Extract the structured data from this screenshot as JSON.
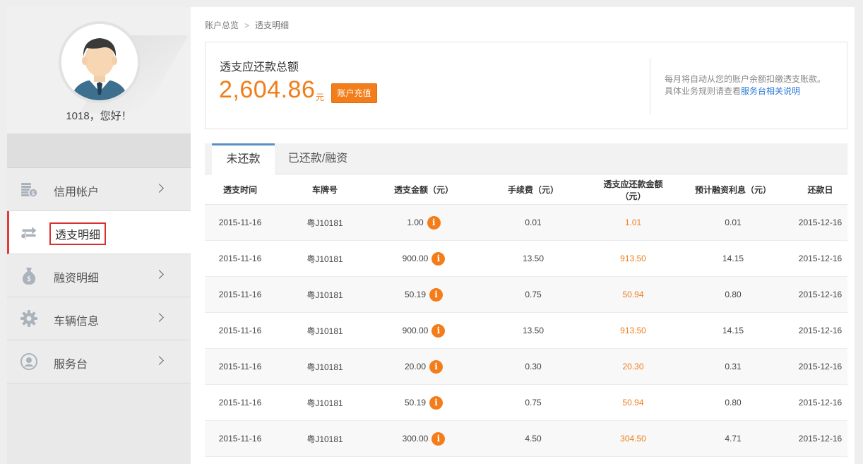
{
  "user": {
    "greeting": "1018，您好！"
  },
  "sidebar": {
    "items": [
      {
        "label": "信用帐户",
        "icon": "coins-icon"
      },
      {
        "label": "透支明细",
        "icon": "transfer-icon",
        "active": true
      },
      {
        "label": "融资明细",
        "icon": "money-bag-icon"
      },
      {
        "label": "车辆信息",
        "icon": "gear-icon"
      },
      {
        "label": "服务台",
        "icon": "service-icon"
      }
    ]
  },
  "breadcrumb": {
    "home": "账户总览",
    "current": "透支明细"
  },
  "summary": {
    "title": "透支应还款总额",
    "amount": "2,604.86",
    "unit": "元",
    "recharge_label": "账户充值",
    "note_line1": "每月将自动从您的账户余额扣缴透支账款。",
    "note_line2_prefix": "具体业务规则请查看",
    "note_link": "服务台相关说明"
  },
  "tabs": [
    {
      "label": "未还款",
      "active": true
    },
    {
      "label": "已还款/融资"
    }
  ],
  "table": {
    "columns": [
      "透支时间",
      "车牌号",
      "透支金额（元）",
      "手续费（元）",
      "透支应还款金额（元）",
      "预计融资利息（元）",
      "还款日"
    ],
    "rows": [
      [
        "2015-11-16",
        "粤J10181",
        "1.00",
        "0.01",
        "1.01",
        "0.01",
        "2015-12-16"
      ],
      [
        "2015-11-16",
        "粤J10181",
        "900.00",
        "13.50",
        "913.50",
        "14.15",
        "2015-12-16"
      ],
      [
        "2015-11-16",
        "粤J10181",
        "50.19",
        "0.75",
        "50.94",
        "0.80",
        "2015-12-16"
      ],
      [
        "2015-11-16",
        "粤J10181",
        "900.00",
        "13.50",
        "913.50",
        "14.15",
        "2015-12-16"
      ],
      [
        "2015-11-16",
        "粤J10181",
        "20.00",
        "0.30",
        "20.30",
        "0.31",
        "2015-12-16"
      ],
      [
        "2015-11-16",
        "粤J10181",
        "50.19",
        "0.75",
        "50.94",
        "0.80",
        "2015-12-16"
      ],
      [
        "2015-11-16",
        "粤J10181",
        "300.00",
        "4.50",
        "304.50",
        "4.71",
        "2015-12-16"
      ]
    ]
  },
  "colors": {
    "accent": "#f07d18",
    "active_border": "#e03a3a",
    "tab_border": "#5a8fc4",
    "link": "#2d7ad6"
  }
}
